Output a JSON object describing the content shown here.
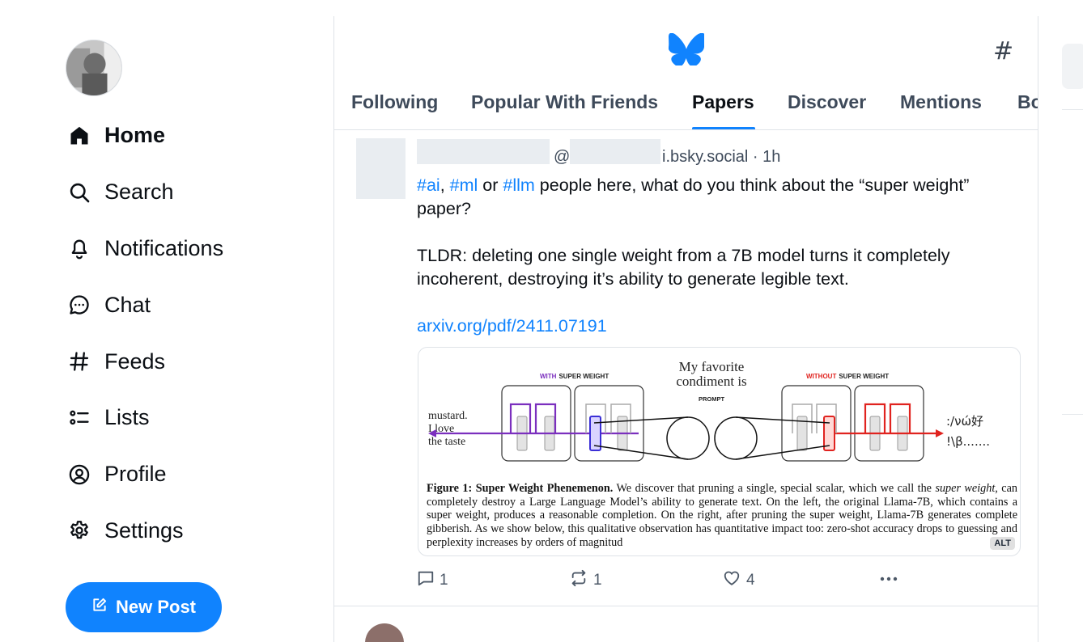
{
  "sidebar": {
    "items": [
      {
        "label": "Home",
        "icon": "home-icon",
        "active": true
      },
      {
        "label": "Search",
        "icon": "search-icon"
      },
      {
        "label": "Notifications",
        "icon": "bell-icon"
      },
      {
        "label": "Chat",
        "icon": "chat-icon"
      },
      {
        "label": "Feeds",
        "icon": "hash-icon"
      },
      {
        "label": "Lists",
        "icon": "list-icon"
      },
      {
        "label": "Profile",
        "icon": "profile-icon"
      },
      {
        "label": "Settings",
        "icon": "gear-icon"
      }
    ],
    "new_post_label": "New Post"
  },
  "header": {
    "logo": "butterfly-icon",
    "feeds_shortcut": "#",
    "tabs": [
      {
        "label": "Following"
      },
      {
        "label": "Popular With Friends"
      },
      {
        "label": "Papers",
        "active": true
      },
      {
        "label": "Discover"
      },
      {
        "label": "Mentions"
      },
      {
        "label": "Bo"
      }
    ]
  },
  "post": {
    "handle_prefix": "@",
    "handle_suffix": "i.bsky.social · 1h",
    "tags": [
      "#ai",
      "#ml",
      "#llm"
    ],
    "text_sep1": ", ",
    "text_sep2": " or ",
    "text_line1_rest": " people here, what do you think about the “super weight” paper?",
    "tldr": "TLDR: deleting one single weight from a 7B model turns it completely incoherent, destroying it’s ability to generate legible text.",
    "link": "arxiv.org/pdf/2411.07191",
    "figure": {
      "left_label": "WITH SUPER WEIGHT",
      "left_label_keyword": "WITH",
      "right_label": "WITHOUT SUPER WEIGHT",
      "right_label_keyword": "WITHOUT",
      "prompt_line1": "My favorite",
      "prompt_line2": "condiment is",
      "prompt_tag": "PROMPT",
      "output_left_line1": "mustard.",
      "output_left_line2": "I love",
      "output_left_line3": "the taste",
      "output_right_line1": ":/νώ好",
      "output_right_line2": "!\\β.......",
      "caption_title": "Figure 1: Super Weight Phenemenon.",
      "caption_part1": " We discover that pruning a single, special scalar, which we call the ",
      "caption_italic": "super weight",
      "caption_part2": ", can completely destroy a Large Language Model’s ability to generate text. On the left, the original Llama-7B, which contains a super weight, produces a reasonable completion. On the right, after pruning the super weight, Llama-7B generates complete gibberish. As we show below, this qualitative observation has quantitative impact too: zero-shot accuracy drops to guessing and perplexity increases by orders of magnitud",
      "alt_badge": "ALT"
    },
    "actions": {
      "replies": "1",
      "reposts": "1",
      "likes": "4"
    }
  },
  "colors": {
    "accent": "#1083fe",
    "purple": "#7b2fbe",
    "red": "#e0231f"
  }
}
